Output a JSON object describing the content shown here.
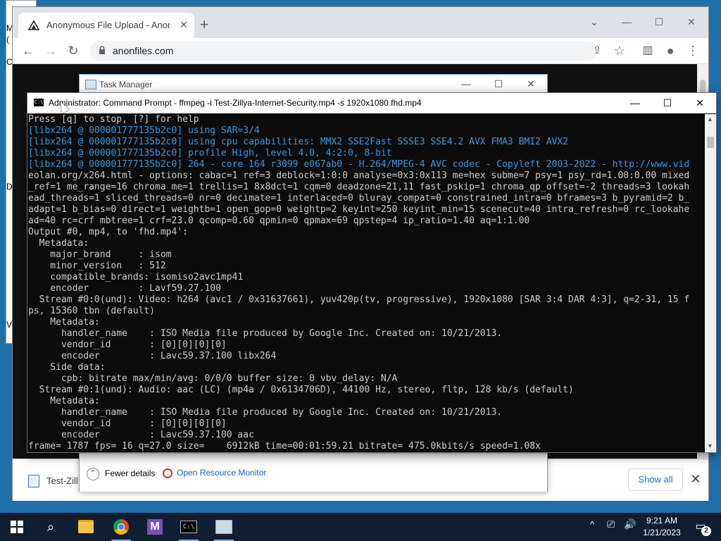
{
  "background_window": {
    "side_chars": [
      "M",
      "(",
      "C",
      "D",
      "V"
    ]
  },
  "chrome": {
    "tab_title": "Anonymous File Upload - AnonFiles",
    "tab_close": "✕",
    "new_tab": "+",
    "url": "anonfiles.com",
    "controls": {
      "minimize": "—",
      "maximize": "☐",
      "close": "✕",
      "tab_search": "⌄"
    },
    "toolbar": {
      "back": "←",
      "forward": "→",
      "reload": "↻",
      "share": "⇪",
      "star": "☆",
      "sidepanel": "▥",
      "profile": "●",
      "menu": "⋮"
    }
  },
  "download_bar": {
    "file_name": "Test-Zill",
    "show_all": "Show all",
    "close": "✕"
  },
  "task_manager": {
    "title": "Task Manager",
    "fewer_details": "Fewer details",
    "open_resource_monitor": "Open Resource Monitor",
    "controls": {
      "minimize": "—",
      "maximize": "☐",
      "close": "✕"
    }
  },
  "cmd": {
    "title": "Administrator:  Command Prompt - ffmpeg  -i Test-Zillya-Internet-Security.mp4 -s 1920x1080 fhd.mp4",
    "controls": {
      "minimize": "—",
      "maximize": "☐",
      "close": "✕"
    },
    "lines": [
      {
        "text": "Press [q] to stop, [?] for help",
        "color": "default"
      },
      {
        "text": "[libx264 @ 000001777135b2c0] using SAR=3/4",
        "color": "cyan"
      },
      {
        "text": "[libx264 @ 000001777135b2c0] using cpu capabilities: MMX2 SSE2Fast SSSE3 SSE4.2 AVX FMA3 BMI2 AVX2",
        "color": "cyan"
      },
      {
        "text": "[libx264 @ 000001777135b2c0] profile High, level 4.0, 4:2:0, 8-bit",
        "color": "cyan"
      },
      {
        "text": "[libx264 @ 000001777135b2c0] 264 - core 164 r3099 e067ab0 - H.264/MPEG-4 AVC codec - Copyleft 2003-2022 - http://www.vid",
        "color": "cyan"
      },
      {
        "text": "eolan.org/x264.html - options: cabac=1 ref=3 deblock=1:0:0 analyse=0x3:0x113 me=hex subme=7 psy=1 psy_rd=1.00:0.00 mixed",
        "color": "default"
      },
      {
        "text": "_ref=1 me_range=16 chroma_me=1 trellis=1 8x8dct=1 cqm=0 deadzone=21,11 fast_pskip=1 chroma_qp_offset=-2 threads=3 lookah",
        "color": "default"
      },
      {
        "text": "ead_threads=1 sliced_threads=0 nr=0 decimate=1 interlaced=0 bluray_compat=0 constrained_intra=0 bframes=3 b_pyramid=2 b_",
        "color": "default"
      },
      {
        "text": "adapt=1 b_bias=0 direct=1 weightb=1 open_gop=0 weightp=2 keyint=250 keyint_min=15 scenecut=40 intra_refresh=0 rc_lookahe",
        "color": "default"
      },
      {
        "text": "ad=40 rc=crf mbtree=1 crf=23.0 qcomp=0.60 qpmin=0 qpmax=69 qpstep=4 ip_ratio=1.40 aq=1:1.00",
        "color": "default"
      },
      {
        "text": "Output #0, mp4, to 'fhd.mp4':",
        "color": "default"
      },
      {
        "text": "  Metadata:",
        "color": "default"
      },
      {
        "text": "    major_brand     : isom",
        "color": "default"
      },
      {
        "text": "    minor_version   : 512",
        "color": "default"
      },
      {
        "text": "    compatible_brands: isomiso2avc1mp41",
        "color": "default"
      },
      {
        "text": "    encoder         : Lavf59.27.100",
        "color": "default"
      },
      {
        "text": "  Stream #0:0(und): Video: h264 (avc1 / 0x31637661), yuv420p(tv, progressive), 1920x1080 [SAR 3:4 DAR 4:3], q=2-31, 15 f",
        "color": "default"
      },
      {
        "text": "ps, 15360 tbn (default)",
        "color": "default"
      },
      {
        "text": "    Metadata:",
        "color": "default"
      },
      {
        "text": "      handler_name    : ISO Media file produced by Google Inc. Created on: 10/21/2013.",
        "color": "default"
      },
      {
        "text": "      vendor_id       : [0][0][0][0]",
        "color": "default"
      },
      {
        "text": "      encoder         : Lavc59.37.100 libx264",
        "color": "default"
      },
      {
        "text": "    Side data:",
        "color": "default"
      },
      {
        "text": "      cpb: bitrate max/min/avg: 0/0/0 buffer size: 0 vbv_delay: N/A",
        "color": "default"
      },
      {
        "text": "  Stream #0:1(und): Audio: aac (LC) (mp4a / 0x6134706D), 44100 Hz, stereo, fltp, 128 kb/s (default)",
        "color": "default"
      },
      {
        "text": "    Metadata:",
        "color": "default"
      },
      {
        "text": "      handler_name    : ISO Media file produced by Google Inc. Created on: 10/21/2013.",
        "color": "default"
      },
      {
        "text": "      vendor_id       : [0][0][0][0]",
        "color": "default"
      },
      {
        "text": "      encoder         : Lavc59.37.100 aac",
        "color": "default"
      },
      {
        "text": "frame= 1787 fps= 16 q=27.0 size=    6912kB time=00:01:59.21 bitrate= 475.0kbits/s speed=1.08x",
        "color": "default"
      }
    ],
    "scroll_up": "▲",
    "scroll_down": "▼"
  },
  "taskbar": {
    "search_icon": "⌕",
    "vs_letter": "M",
    "cmd_prompt": "C:\\",
    "tray_chevron": "^",
    "tray_network": "⎚",
    "tray_volume": "🔊",
    "time": "9:21 AM",
    "date": "1/21/2023",
    "notifications_icon": "▭",
    "notification_count": "2"
  },
  "colors": {
    "desktop": "#1f6fa8",
    "taskbar": "#0f1e33",
    "cmd_bg": "#0c0c0c",
    "cmd_text": "#cccccc",
    "cmd_cyan": "#3a96dd",
    "link_blue": "#1a73e8"
  }
}
